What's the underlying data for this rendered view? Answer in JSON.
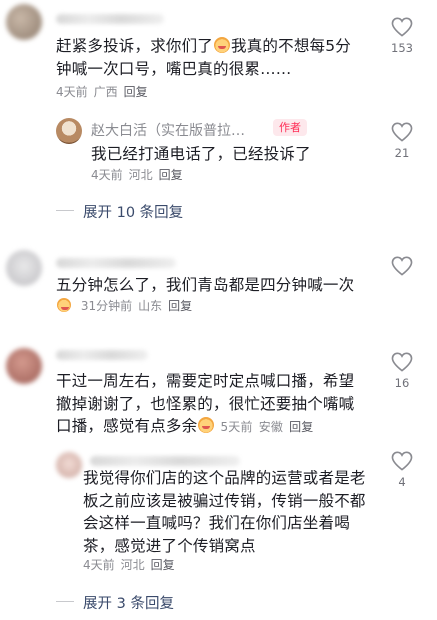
{
  "comments": [
    {
      "text_a": "赶紧多投诉，求你们了",
      "text_b": "我真的不想每5分钟喊一次口号，嘴巴真的很累……",
      "time": "4天前",
      "location": "广西",
      "reply": "回复",
      "likes": "153",
      "emoji": "crying-face-emoji",
      "author_reply": {
        "name": "赵大白活（实在版普拉…",
        "badge": "作者",
        "text": "我已经打通电话了，已经投诉了",
        "time": "4天前",
        "location": "河北",
        "reply": "回复",
        "likes": "21"
      },
      "expand": "展开 10 条回复"
    },
    {
      "text": "五分钟怎么了，我们青岛都是四分钟喊一次",
      "time": "31分钟前",
      "location": "山东",
      "reply": "回复",
      "likes": "",
      "emoji": "small-face-emoji"
    },
    {
      "text_a": "干过一周左右，需要定时定点喊口播，希望撤掉谢谢了，也怪累的，很忙还要抽个嘴喊口播，感觉有点多余",
      "time": "5天前",
      "location": "安徽",
      "reply": "回复",
      "likes": "16",
      "emoji": "crying-face-emoji",
      "sub_reply": {
        "text": "我觉得你们店的这个品牌的运营或者是老板之前应该是被骗过传销，传销一般不都会这样一直喊吗？我们在你们店坐着喝茶，感觉进了个传销窝点",
        "time": "4天前",
        "location": "河北",
        "reply": "回复",
        "likes": "4"
      },
      "expand": "展开 3 条回复"
    }
  ],
  "colors": {
    "accent": "#fe2c55",
    "text": "#1c1d24",
    "muted": "#8a8b91",
    "link": "#3a4a6b"
  },
  "icons": {
    "like": "heart-outline-icon"
  }
}
